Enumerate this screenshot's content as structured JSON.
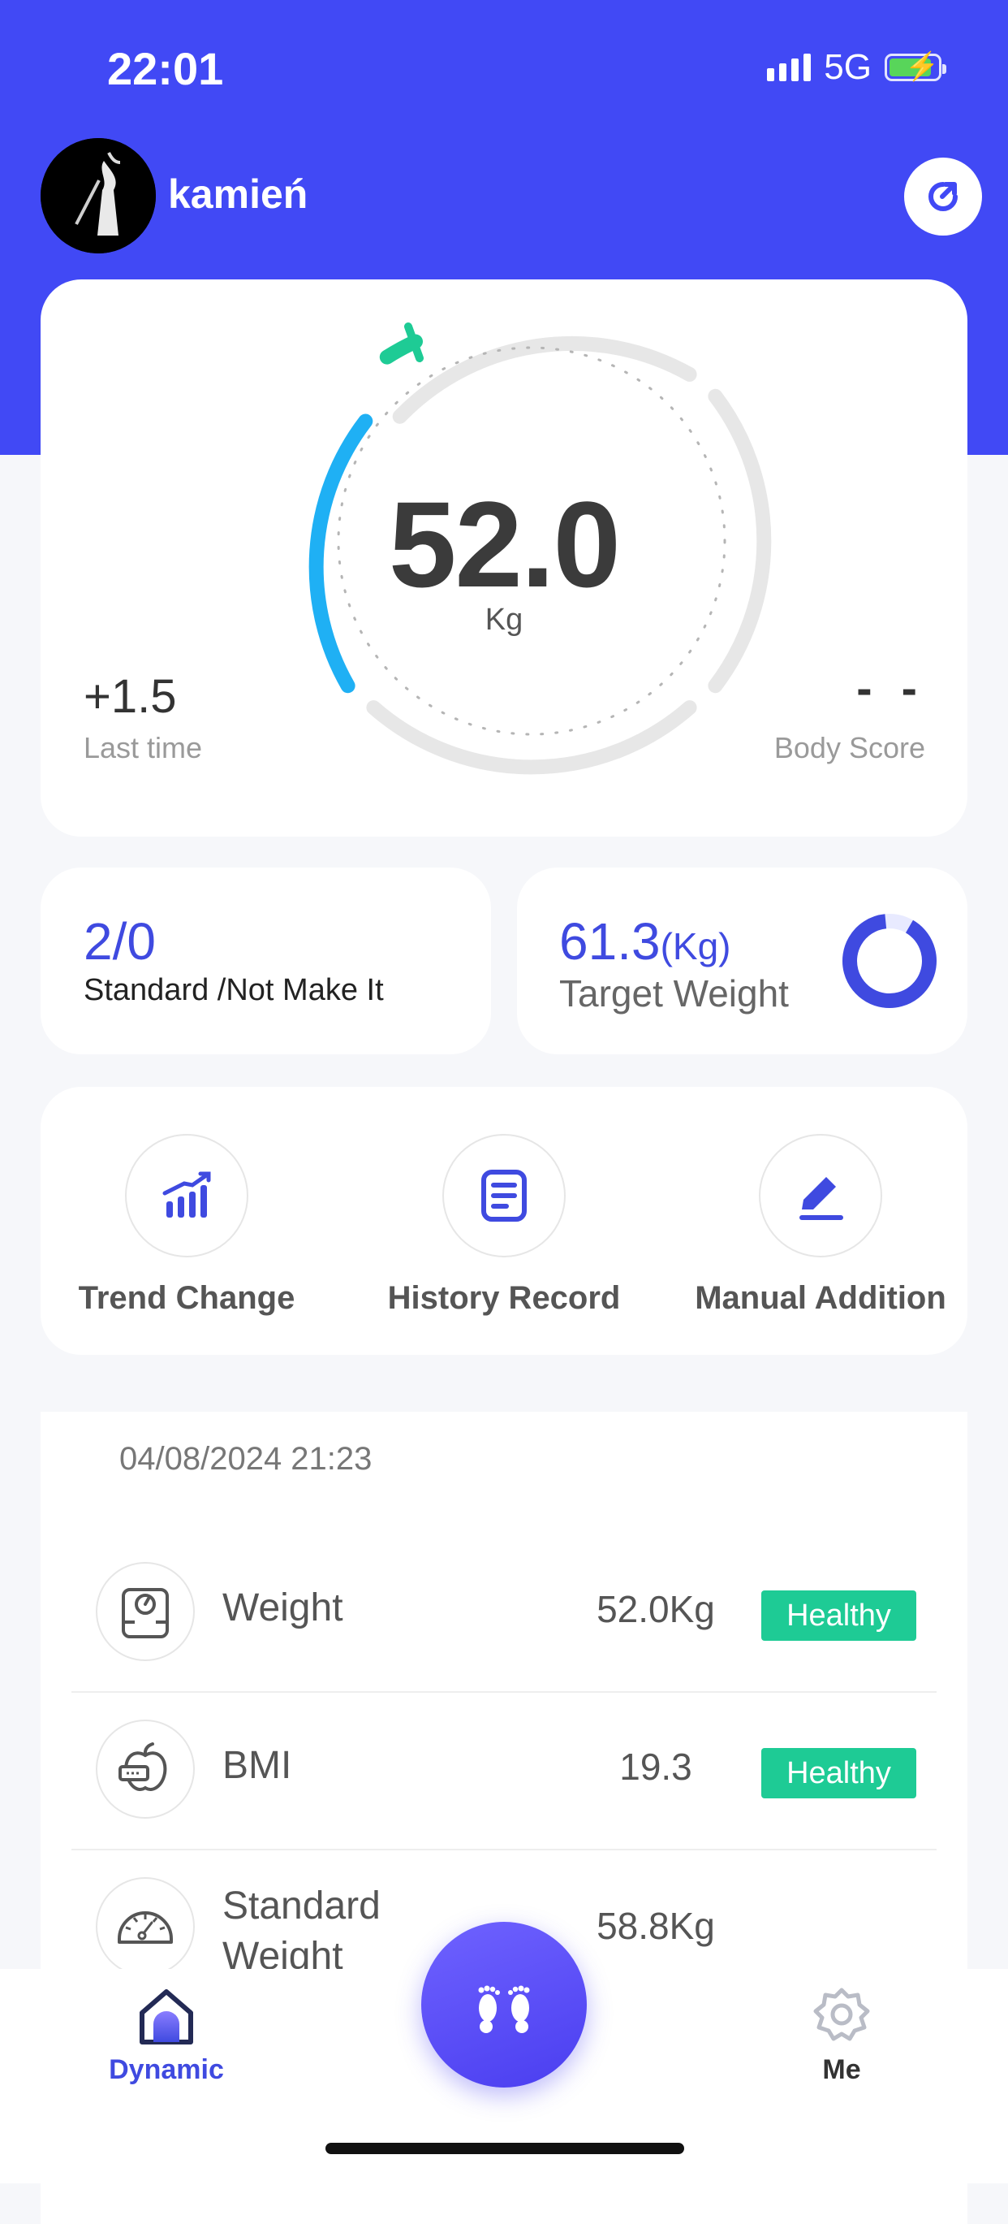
{
  "status_bar": {
    "time": "22:01",
    "network": "5G"
  },
  "header": {
    "username": "kamień"
  },
  "weight_card": {
    "value": "52.0",
    "unit": "Kg",
    "last_change": "+1.5",
    "last_label": "Last time",
    "body_score": "- -",
    "body_score_label": "Body Score"
  },
  "standard_card": {
    "value": "2/0",
    "label": "Standard /Not Make It"
  },
  "target_card": {
    "value": "61.3",
    "unit": "(Kg)",
    "label": "Target Weight"
  },
  "actions": [
    {
      "label": "Trend Change",
      "icon": "trend-chart-icon"
    },
    {
      "label": "History Record",
      "icon": "document-icon"
    },
    {
      "label": "Manual Addition",
      "icon": "pencil-icon"
    }
  ],
  "records": {
    "date": "04/08/2024 21:23",
    "items": [
      {
        "name": "Weight",
        "value": "52.0Kg",
        "status": "Healthy",
        "icon": "scale-icon"
      },
      {
        "name": "BMI",
        "value": "19.3",
        "status": "Healthy",
        "icon": "apple-tape-icon"
      },
      {
        "name_line1": "Standard",
        "name_line2": "Weight",
        "value": "58.8Kg",
        "icon": "speedometer-icon"
      }
    ]
  },
  "tabbar": {
    "dynamic": "Dynamic",
    "me": "Me"
  },
  "colors": {
    "brand": "#4149f5",
    "healthy": "#1ecb95",
    "gauge_blue": "#1fb0f4",
    "gauge_green": "#1ecb95"
  }
}
